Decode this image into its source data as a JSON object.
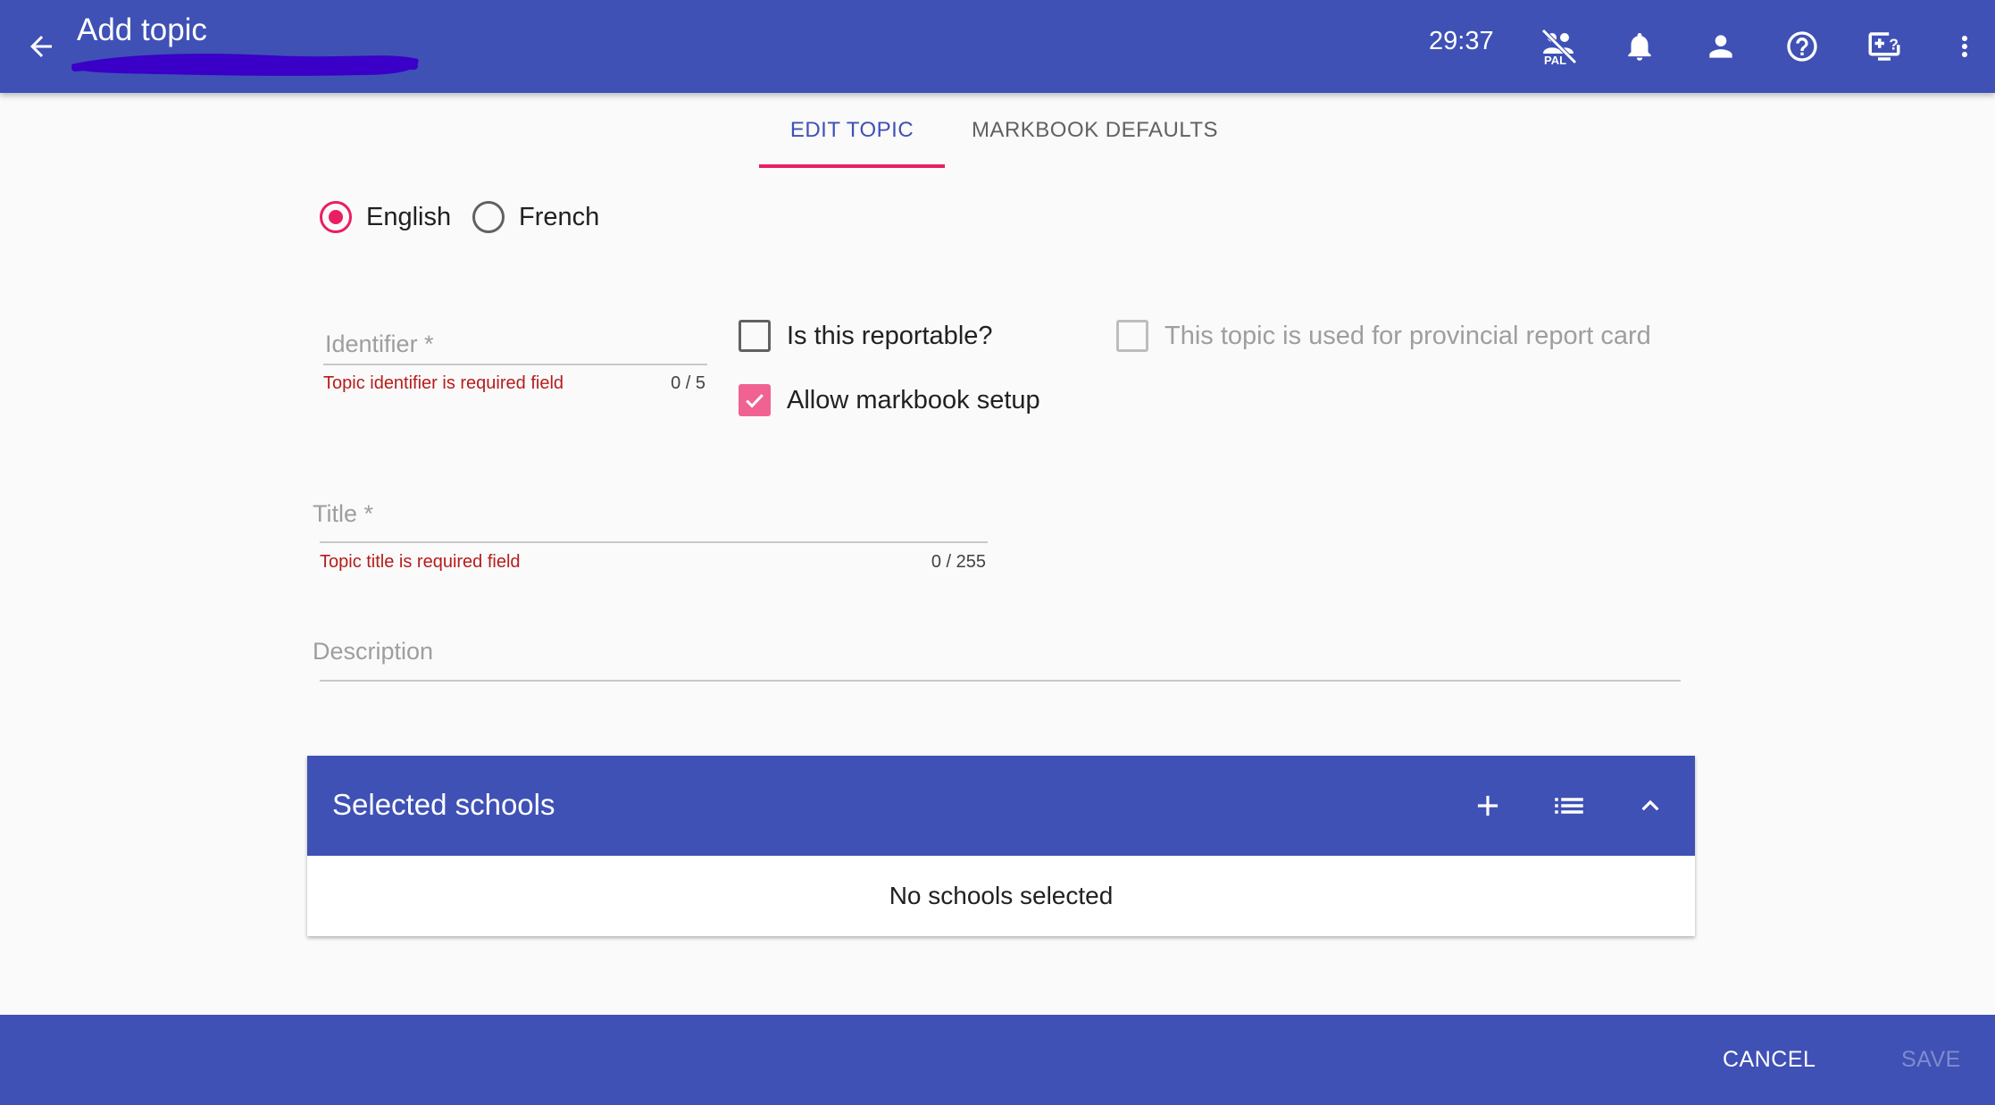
{
  "header": {
    "title": "Add topic",
    "timer": "29:37",
    "icons": [
      "arrow-back-icon",
      "pal-off-icon",
      "notifications-icon",
      "account-icon",
      "help-icon",
      "remote-support-icon",
      "more-vert-icon"
    ]
  },
  "tabs": [
    {
      "label": "EDIT TOPIC",
      "active": true
    },
    {
      "label": "MARKBOOK DEFAULTS",
      "active": false
    }
  ],
  "language": {
    "options": [
      {
        "label": "English",
        "selected": true
      },
      {
        "label": "French",
        "selected": false
      }
    ]
  },
  "identifier": {
    "label": "Identifier *",
    "value": "",
    "error": "Topic identifier is required field",
    "counter": "0 / 5"
  },
  "checkboxes": {
    "reportable": {
      "label": "Is this reportable?",
      "checked": false
    },
    "markbook": {
      "label": "Allow markbook setup",
      "checked": true
    },
    "provincial": {
      "label": "This topic is used for provincial report card",
      "checked": false,
      "disabled": true
    }
  },
  "title_field": {
    "label": "Title *",
    "value": "",
    "error": "Topic title is required field",
    "counter": "0 / 255"
  },
  "description_field": {
    "label": "Description",
    "value": ""
  },
  "schools": {
    "title": "Selected schools",
    "empty_text": "No schools selected",
    "icons": [
      "add-icon",
      "list-icon",
      "chevron-up-icon"
    ]
  },
  "footer": {
    "cancel_label": "CANCEL",
    "save_label": "SAVE"
  },
  "colors": {
    "primary": "#3f51b5",
    "accent": "#e91e63",
    "error": "#b71c1c",
    "redaction": "#3a00c8"
  }
}
